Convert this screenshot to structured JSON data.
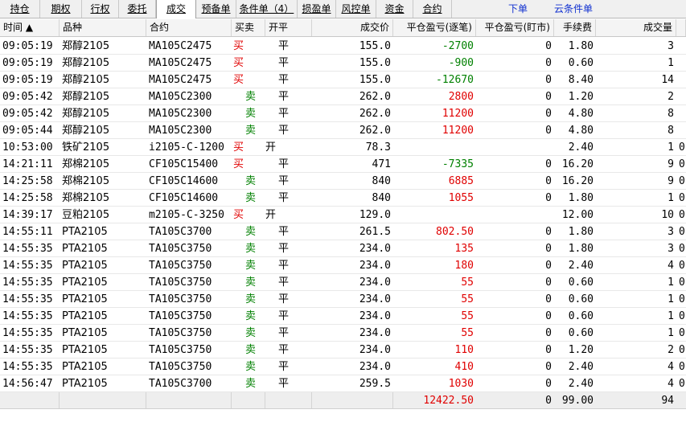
{
  "tabs": [
    {
      "label": "持仓",
      "active": false
    },
    {
      "label": "期权",
      "active": false
    },
    {
      "label": "行权",
      "active": false
    },
    {
      "label": "委托",
      "active": false
    },
    {
      "label": "成交",
      "active": true
    },
    {
      "label": "预备单",
      "active": false
    },
    {
      "label": "条件单（4）",
      "active": false
    },
    {
      "label": "损盈单",
      "active": false
    },
    {
      "label": "风控单",
      "active": false
    },
    {
      "label": "资金",
      "active": false
    },
    {
      "label": "合约",
      "active": false
    }
  ],
  "links": {
    "order": "下单",
    "cloud_condition": "云条件单"
  },
  "columns": {
    "time": "时间 ▲",
    "product": "品种",
    "contract": "合约",
    "buysell": "买卖",
    "openclose": "开平",
    "price": "成交价",
    "pnl_trade": "平仓盈亏(逐笔)",
    "pnl_daily": "平仓盈亏(盯市)",
    "fee": "手续费",
    "volume": "成交量"
  },
  "rows": [
    {
      "time": "09:05:19",
      "product": "郑醇2105",
      "contract": "MA105C2475",
      "side": "买",
      "oc": "平",
      "price": "155.0",
      "pnl": "-2700",
      "daily": "0",
      "fee": "1.80",
      "vol": "3",
      "x": ""
    },
    {
      "time": "09:05:19",
      "product": "郑醇2105",
      "contract": "MA105C2475",
      "side": "买",
      "oc": "平",
      "price": "155.0",
      "pnl": "-900",
      "daily": "0",
      "fee": "0.60",
      "vol": "1",
      "x": ""
    },
    {
      "time": "09:05:19",
      "product": "郑醇2105",
      "contract": "MA105C2475",
      "side": "买",
      "oc": "平",
      "price": "155.0",
      "pnl": "-12670",
      "daily": "0",
      "fee": "8.40",
      "vol": "14",
      "x": ""
    },
    {
      "time": "09:05:42",
      "product": "郑醇2105",
      "contract": "MA105C2300",
      "side": "卖",
      "oc": "平",
      "price": "262.0",
      "pnl": "2800",
      "daily": "0",
      "fee": "1.20",
      "vol": "2",
      "x": ""
    },
    {
      "time": "09:05:42",
      "product": "郑醇2105",
      "contract": "MA105C2300",
      "side": "卖",
      "oc": "平",
      "price": "262.0",
      "pnl": "11200",
      "daily": "0",
      "fee": "4.80",
      "vol": "8",
      "x": ""
    },
    {
      "time": "09:05:44",
      "product": "郑醇2105",
      "contract": "MA105C2300",
      "side": "卖",
      "oc": "平",
      "price": "262.0",
      "pnl": "11200",
      "daily": "0",
      "fee": "4.80",
      "vol": "8",
      "x": ""
    },
    {
      "time": "10:53:00",
      "product": "铁矿2105",
      "contract": "i2105-C-1200",
      "side": "买",
      "oc": "开",
      "price": "78.3",
      "pnl": "",
      "daily": "",
      "fee": "2.40",
      "vol": "1",
      "x": "0"
    },
    {
      "time": "14:21:11",
      "product": "郑棉2105",
      "contract": "CF105C15400",
      "side": "买",
      "oc": "平",
      "price": "471",
      "pnl": "-7335",
      "daily": "0",
      "fee": "16.20",
      "vol": "9",
      "x": "0"
    },
    {
      "time": "14:25:58",
      "product": "郑棉2105",
      "contract": "CF105C14600",
      "side": "卖",
      "oc": "平",
      "price": "840",
      "pnl": "6885",
      "daily": "0",
      "fee": "16.20",
      "vol": "9",
      "x": "0"
    },
    {
      "time": "14:25:58",
      "product": "郑棉2105",
      "contract": "CF105C14600",
      "side": "卖",
      "oc": "平",
      "price": "840",
      "pnl": "1055",
      "daily": "0",
      "fee": "1.80",
      "vol": "1",
      "x": "0"
    },
    {
      "time": "14:39:17",
      "product": "豆粕2105",
      "contract": "m2105-C-3250",
      "side": "买",
      "oc": "开",
      "price": "129.0",
      "pnl": "",
      "daily": "",
      "fee": "12.00",
      "vol": "10",
      "x": "0"
    },
    {
      "time": "14:55:11",
      "product": "PTA2105",
      "contract": "TA105C3700",
      "side": "卖",
      "oc": "平",
      "price": "261.5",
      "pnl": "802.50",
      "daily": "0",
      "fee": "1.80",
      "vol": "3",
      "x": "0"
    },
    {
      "time": "14:55:35",
      "product": "PTA2105",
      "contract": "TA105C3750",
      "side": "卖",
      "oc": "平",
      "price": "234.0",
      "pnl": "135",
      "daily": "0",
      "fee": "1.80",
      "vol": "3",
      "x": "0"
    },
    {
      "time": "14:55:35",
      "product": "PTA2105",
      "contract": "TA105C3750",
      "side": "卖",
      "oc": "平",
      "price": "234.0",
      "pnl": "180",
      "daily": "0",
      "fee": "2.40",
      "vol": "4",
      "x": "0"
    },
    {
      "time": "14:55:35",
      "product": "PTA2105",
      "contract": "TA105C3750",
      "side": "卖",
      "oc": "平",
      "price": "234.0",
      "pnl": "55",
      "daily": "0",
      "fee": "0.60",
      "vol": "1",
      "x": "0"
    },
    {
      "time": "14:55:35",
      "product": "PTA2105",
      "contract": "TA105C3750",
      "side": "卖",
      "oc": "平",
      "price": "234.0",
      "pnl": "55",
      "daily": "0",
      "fee": "0.60",
      "vol": "1",
      "x": "0"
    },
    {
      "time": "14:55:35",
      "product": "PTA2105",
      "contract": "TA105C3750",
      "side": "卖",
      "oc": "平",
      "price": "234.0",
      "pnl": "55",
      "daily": "0",
      "fee": "0.60",
      "vol": "1",
      "x": "0"
    },
    {
      "time": "14:55:35",
      "product": "PTA2105",
      "contract": "TA105C3750",
      "side": "卖",
      "oc": "平",
      "price": "234.0",
      "pnl": "55",
      "daily": "0",
      "fee": "0.60",
      "vol": "1",
      "x": "0"
    },
    {
      "time": "14:55:35",
      "product": "PTA2105",
      "contract": "TA105C3750",
      "side": "卖",
      "oc": "平",
      "price": "234.0",
      "pnl": "110",
      "daily": "0",
      "fee": "1.20",
      "vol": "2",
      "x": "0"
    },
    {
      "time": "14:55:35",
      "product": "PTA2105",
      "contract": "TA105C3750",
      "side": "卖",
      "oc": "平",
      "price": "234.0",
      "pnl": "410",
      "daily": "0",
      "fee": "2.40",
      "vol": "4",
      "x": "0"
    },
    {
      "time": "14:56:47",
      "product": "PTA2105",
      "contract": "TA105C3700",
      "side": "卖",
      "oc": "平",
      "price": "259.5",
      "pnl": "1030",
      "daily": "0",
      "fee": "2.40",
      "vol": "4",
      "x": "0"
    }
  ],
  "summary": {
    "pnl": "12422.50",
    "daily": "0",
    "fee": "99.00",
    "vol": "94"
  },
  "colors": {
    "red": "#e00000",
    "green": "#008000",
    "link": "#1030d0"
  }
}
